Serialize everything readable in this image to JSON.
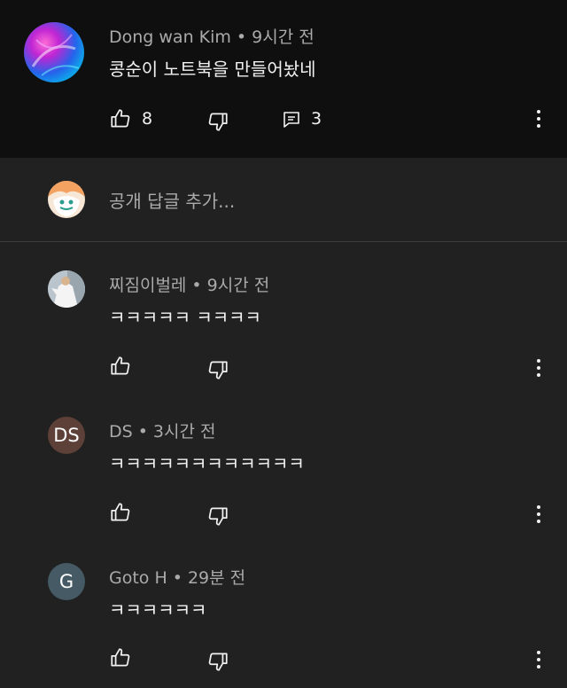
{
  "main_comment": {
    "author": "Dong wan Kim",
    "time": "9시간 전",
    "text": "콩순이 노트북을 만들어놨네",
    "likes": "8",
    "replies": "3"
  },
  "reply_box": {
    "placeholder": "공개 답글 추가..."
  },
  "replies": [
    {
      "author": "찌짐이벌레",
      "time": "9시간 전",
      "text": "ㅋㅋㅋㅋㅋ ㅋㅋㅋㅋ"
    },
    {
      "author": "DS",
      "time": "3시간 전",
      "text": "ㅋㅋㅋㅋㅋㅋㅋㅋㅋㅋㅋㅋ",
      "avatar_letters": "DS",
      "avatar_color": "#5d4037"
    },
    {
      "author": "Goto H",
      "time": "29분 전",
      "text": "ㅋㅋㅋㅋㅋㅋ",
      "avatar_letters": "G",
      "avatar_color": "#455a64"
    }
  ],
  "icons": {
    "like": "thumb-up-icon",
    "dislike": "thumb-down-icon",
    "reply": "reply-icon",
    "menu": "more-vert-icon"
  }
}
